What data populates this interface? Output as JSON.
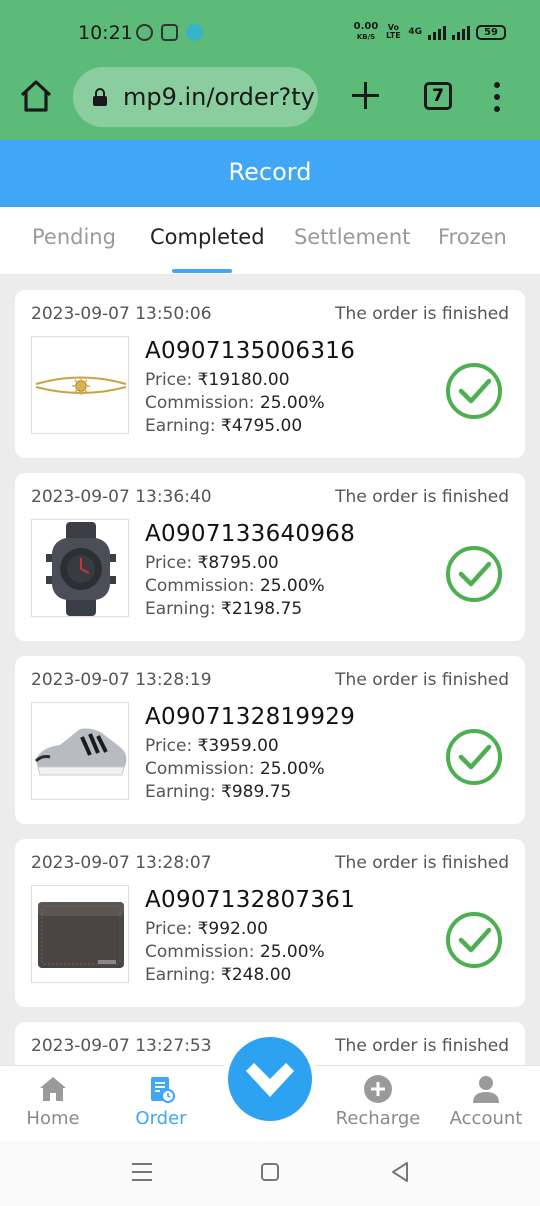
{
  "status_bar": {
    "time": "10:21",
    "net_speed": "0.00",
    "net_unit": "KB/S",
    "volte": "Vo LTE",
    "net_type": "4G",
    "battery": "59"
  },
  "browser": {
    "url": "mp9.in/order?ty",
    "tab_count": "7"
  },
  "header": {
    "title": "Record"
  },
  "tabs": [
    {
      "label": "Pending"
    },
    {
      "label": "Completed"
    },
    {
      "label": "Settlement"
    },
    {
      "label": "Frozen"
    }
  ],
  "labels": {
    "price": "Price:",
    "commission": "Commission:",
    "earning": "Earning:"
  },
  "orders": [
    {
      "date": "2023-09-07 13:50:06",
      "status": "The order is finished",
      "order_no": "A0907135006316",
      "price": "₹19180.00",
      "commission": "25.00%",
      "earning": "₹4795.00",
      "product_icon": "bracelet"
    },
    {
      "date": "2023-09-07 13:36:40",
      "status": "The order is finished",
      "order_no": "A0907133640968",
      "price": "₹8795.00",
      "commission": "25.00%",
      "earning": "₹2198.75",
      "product_icon": "watch"
    },
    {
      "date": "2023-09-07 13:28:19",
      "status": "The order is finished",
      "order_no": "A0907132819929",
      "price": "₹3959.00",
      "commission": "25.00%",
      "earning": "₹989.75",
      "product_icon": "sneaker"
    },
    {
      "date": "2023-09-07 13:28:07",
      "status": "The order is finished",
      "order_no": "A0907132807361",
      "price": "₹992.00",
      "commission": "25.00%",
      "earning": "₹248.00",
      "product_icon": "wallet"
    },
    {
      "date": "2023-09-07 13:27:53",
      "status": "The order is finished"
    }
  ],
  "bottom_nav": [
    {
      "label": "Home"
    },
    {
      "label": "Order"
    },
    {
      "label": "Recharge"
    },
    {
      "label": "Account"
    }
  ],
  "colors": {
    "accent": "#3fa7f5",
    "chrome": "#5dbb7a",
    "success": "#4caf50"
  }
}
